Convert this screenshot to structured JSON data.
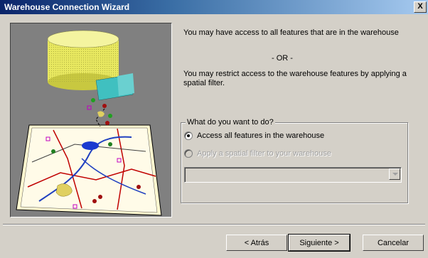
{
  "window": {
    "title": "Warehouse Connection Wizard",
    "close_glyph": "X"
  },
  "content": {
    "text_all": "You may have access to all features that are in the warehouse",
    "or_text": "- OR -",
    "text_restrict": "You may restrict access to the warehouse features by applying a spatial filter."
  },
  "group": {
    "legend": "What do you want to do?",
    "options": [
      {
        "label": "Access all features in the warehouse",
        "selected": true,
        "enabled": true
      },
      {
        "label": "Apply a spatial filter to your warehouse",
        "selected": false,
        "enabled": false
      }
    ],
    "combo_value": ""
  },
  "buttons": {
    "back": "< Atrás",
    "next": "Siguiente >",
    "cancel": "Cancelar"
  },
  "illustration": {
    "icon": "database-map-illustration"
  }
}
